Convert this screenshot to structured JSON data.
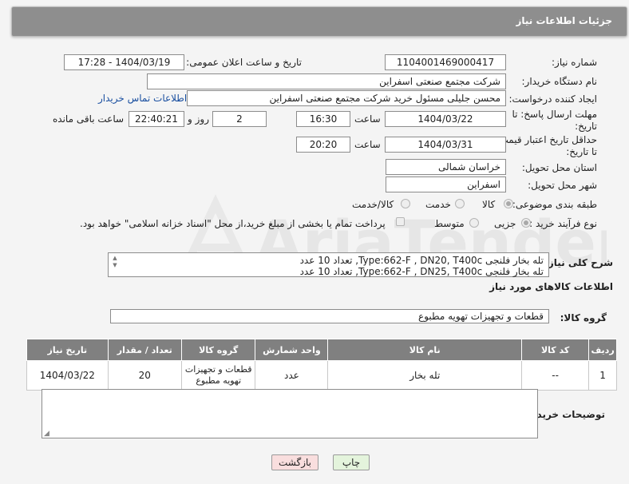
{
  "header": {
    "title": "جزئیات اطلاعات نیاز"
  },
  "form": {
    "need_number": {
      "label": "شماره نیاز:",
      "value": "1104001469000417"
    },
    "announce_datetime": {
      "label": "تاریخ و ساعت اعلان عمومی:",
      "value": "1404/03/19 - 17:28"
    },
    "buyer_org": {
      "label": "نام دستگاه خریدار:",
      "value": "شرکت مجتمع صنعتی اسفراین"
    },
    "requester": {
      "label": "ایجاد کننده درخواست:",
      "value": "محسن جلیلی مسئول خرید شرکت مجتمع صنعتی اسفراین",
      "contact_link": "اطلاعات تماس خریدار"
    },
    "response_deadline": {
      "label_line1": "مهلت ارسال پاسخ: تا",
      "label_line2": "تاریخ:",
      "date": "1404/03/22",
      "time_label": "ساعت",
      "time": "16:30",
      "days": "2",
      "days_label": "روز و",
      "remaining": "22:40:21",
      "remaining_label": "ساعت باقی مانده"
    },
    "price_validity": {
      "label_line1": "حداقل تاریخ اعتبار قیمت:",
      "label_line2": "تا تاریخ:",
      "date": "1404/03/31",
      "time_label": "ساعت",
      "time": "20:20"
    },
    "province": {
      "label": "استان محل تحویل:",
      "value": "خراسان شمالی"
    },
    "city": {
      "label": "شهر محل تحویل:",
      "value": "اسفراین"
    },
    "category": {
      "label": "طبقه بندی موضوعی:",
      "options": [
        "کالا",
        "خدمت",
        "کالا/خدمت"
      ],
      "selected": "کالا"
    },
    "process_type": {
      "label": "نوع فرآیند خرید :",
      "options": [
        "جزیی",
        "متوسط"
      ],
      "selected": "جزیی",
      "payment_note": "پرداخت تمام یا بخشی از مبلغ خرید،از محل \"اسناد خزانه اسلامی\" خواهد بود."
    },
    "description": {
      "label": "شرح کلی نیاز:",
      "line1": "تله بخار فلنجی Type:662-F , DN20, T400c, تعداد 10 عدد",
      "line2": "تله بخار فلنجی Type:662-F , DN25, T400c, تعداد 10 عدد"
    }
  },
  "goods": {
    "section_title": "اطلاعات کالاهای مورد نیاز",
    "group_label": "گروه کالا:",
    "group_value": "قطعات و تجهیزات تهویه مطبوع",
    "table": {
      "headers": [
        "ردیف",
        "کد کالا",
        "نام کالا",
        "واحد شمارش",
        "گروه کالا",
        "تعداد / مقدار",
        "تاریخ نیاز"
      ],
      "rows": [
        {
          "row": "1",
          "code": "--",
          "name": "تله بخار",
          "unit": "عدد",
          "group": "قطعات و تجهیزات تهویه مطبوع",
          "qty": "20",
          "date": "1404/03/22"
        }
      ]
    }
  },
  "buyer_notes": {
    "label": "توضیحات خریدار:",
    "value": ""
  },
  "buttons": {
    "print": "چاپ",
    "back": "بازگشت"
  },
  "watermark": {
    "text": "AriaTender.neT"
  },
  "colors": {
    "header_bg": "#8e8e8e",
    "table_header_bg": "#808080",
    "link": "#1a4fa0",
    "back_button_bg": "#f9dede",
    "print_button_bg": "#e4f4dc"
  }
}
